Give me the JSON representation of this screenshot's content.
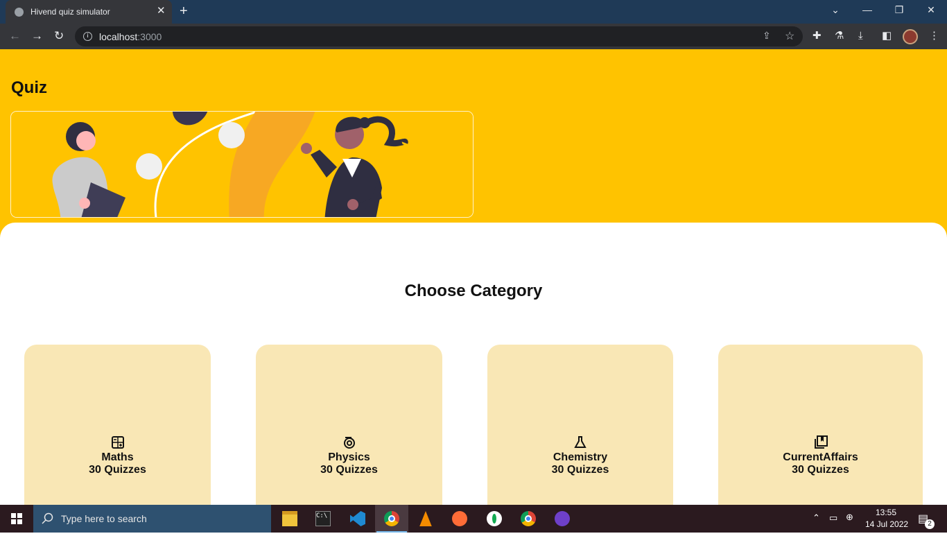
{
  "browser": {
    "tab_title": "Hivend quiz simulator",
    "tab_close_glyph": "✕",
    "new_tab_glyph": "+",
    "url_host": "localhost",
    "url_port": ":3000"
  },
  "page": {
    "title": "Quiz",
    "section_title": "Choose Category",
    "categories": [
      {
        "name": "Maths",
        "count": "30 Quizzes",
        "icon": "calculator-icon"
      },
      {
        "name": "Physics",
        "count": "30 Quizzes",
        "icon": "atom-icon"
      },
      {
        "name": "Chemistry",
        "count": "30 Quizzes",
        "icon": "flask-icon"
      },
      {
        "name": "CurrentAffairs",
        "count": "30 Quizzes",
        "icon": "newspaper-icon"
      }
    ]
  },
  "taskbar": {
    "search_placeholder": "Type here to search",
    "time": "13:55",
    "date": "14 Jul 2022",
    "notifications": "2"
  },
  "colors": {
    "brand": "#ffc300",
    "card": "#f9e7b5",
    "tab_strip": "#1f3a57"
  }
}
